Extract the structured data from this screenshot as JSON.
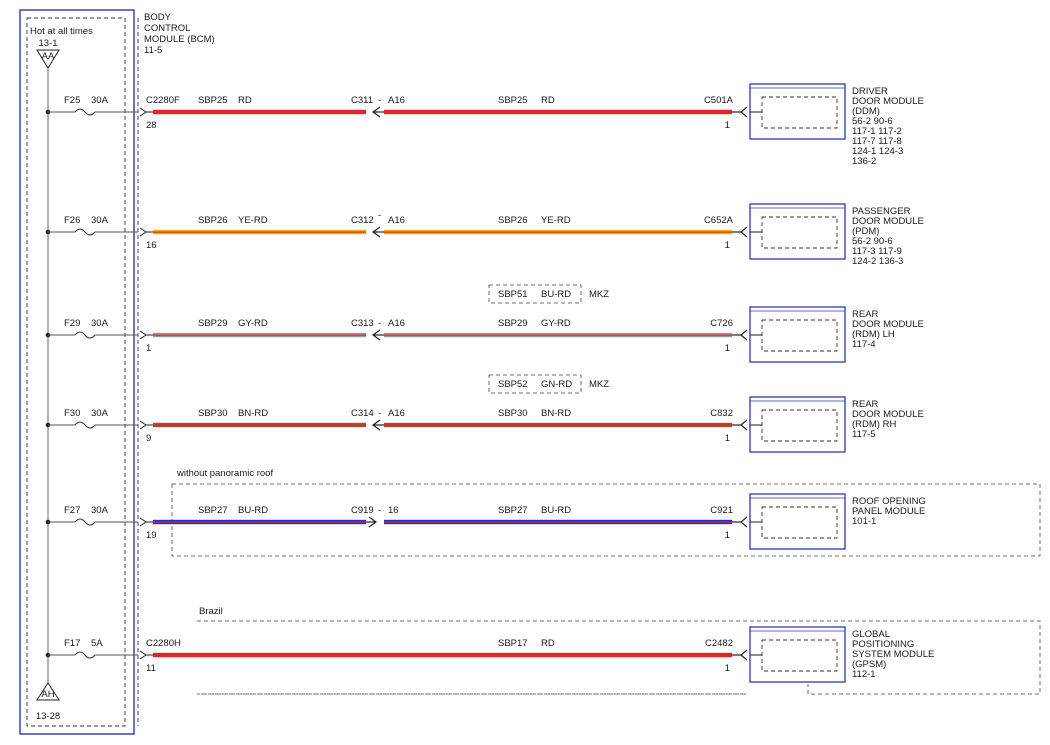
{
  "bcm": {
    "hot_label": "Hot at all times",
    "bus_top_ref": "13-1",
    "bus_top_tag": "AA",
    "bus_bottom_tag": "AH",
    "bus_bottom_ref": "13-28",
    "name_lines": [
      "BODY",
      "CONTROL",
      "MODULE (BCM)",
      "11-5"
    ]
  },
  "circuits": [
    {
      "fuse": "F25",
      "amps": "30A",
      "bcm_connector": "C2280F",
      "bcm_pin": "28",
      "wire_left": "SBP25",
      "color_left": "RD",
      "inline": "C311",
      "inline_sep": "-",
      "inline_pin": "A16",
      "wire_right": "SBP25",
      "color_right": "RD",
      "module_connector": "C501A",
      "module_pin": "1",
      "module_lines": [
        "DRIVER",
        "DOOR MODULE",
        "(DDM)",
        "56-2   90-6",
        "117-1   117-2",
        "117-7   117-8",
        "124-1   124-3",
        "136-2"
      ],
      "wire_colors": [
        "#e0262a"
      ],
      "inline_dir": "left",
      "option_box": null,
      "option_region": null
    },
    {
      "fuse": "F26",
      "amps": "30A",
      "bcm_connector": "",
      "bcm_pin": "16",
      "wire_left": "SBP26",
      "color_left": "YE-RD",
      "inline": "C312",
      "inline_sep": "-",
      "inline_pin": "A16",
      "wire_right": "SBP26",
      "color_right": "YE-RD",
      "module_connector": "C652A",
      "module_pin": "1",
      "module_lines": [
        "PASSENGER",
        "DOOR MODULE",
        "(PDM)",
        "56-2   90-6",
        "117-3   117-9",
        "124-2   136-3"
      ],
      "wire_colors": [
        "#f0b400",
        "#e0262a"
      ],
      "inline_dir": "left",
      "option_box": null,
      "option_region": null
    },
    {
      "fuse": "F29",
      "amps": "30A",
      "bcm_connector": "",
      "bcm_pin": "1",
      "wire_left": "SBP29",
      "color_left": "GY-RD",
      "inline": "C313",
      "inline_sep": "-",
      "inline_pin": "A16",
      "wire_right": "SBP29",
      "color_right": "GY-RD",
      "module_connector": "C726",
      "module_pin": "1",
      "module_lines": [
        "REAR",
        "DOOR MODULE",
        "(RDM) LH",
        "117-4"
      ],
      "wire_colors": [
        "#9a9a9a",
        "#e0262a"
      ],
      "inline_dir": "left",
      "option_box": {
        "wire": "SBP51",
        "color": "BU-RD",
        "tag": "MKZ"
      },
      "option_region": null
    },
    {
      "fuse": "F30",
      "amps": "30A",
      "bcm_connector": "",
      "bcm_pin": "9",
      "wire_left": "SBP30",
      "color_left": "BN-RD",
      "inline": "C314",
      "inline_sep": "-",
      "inline_pin": "A16",
      "wire_right": "SBP30",
      "color_right": "BN-RD",
      "module_connector": "C832",
      "module_pin": "1",
      "module_lines": [
        "REAR",
        "DOOR MODULE",
        "(RDM) RH",
        "117-5"
      ],
      "wire_colors": [
        "#a0522d",
        "#e0262a"
      ],
      "inline_dir": "left",
      "option_box": {
        "wire": "SBP52",
        "color": "GN-RD",
        "tag": "MKZ"
      },
      "option_region": null
    },
    {
      "fuse": "F27",
      "amps": "30A",
      "bcm_connector": "",
      "bcm_pin": "19",
      "wire_left": "SBP27",
      "color_left": "BU-RD",
      "inline": "C919",
      "inline_sep": "-",
      "inline_pin": "16",
      "wire_right": "SBP27",
      "color_right": "BU-RD",
      "module_connector": "C921",
      "module_pin": "1",
      "module_lines": [
        "ROOF OPENING",
        "PANEL MODULE",
        "101-1"
      ],
      "wire_colors": [
        "#1f2fd6",
        "#e0262a"
      ],
      "inline_dir": "right",
      "option_box": null,
      "option_region": "without panoramic roof"
    },
    {
      "fuse": "F17",
      "amps": "5A",
      "bcm_connector": "C2280H",
      "bcm_pin": "11",
      "wire_left": "",
      "color_left": "",
      "inline": "",
      "inline_sep": "",
      "inline_pin": "",
      "wire_right": "SBP17",
      "color_right": "RD",
      "module_connector": "C2482",
      "module_pin": "1",
      "module_lines": [
        "GLOBAL",
        "POSITIONING",
        "SYSTEM MODULE",
        "(GPSM)",
        "112-1"
      ],
      "wire_colors": [
        "#e0262a"
      ],
      "inline_dir": "none",
      "option_box": null,
      "option_region": "Brazil"
    }
  ]
}
